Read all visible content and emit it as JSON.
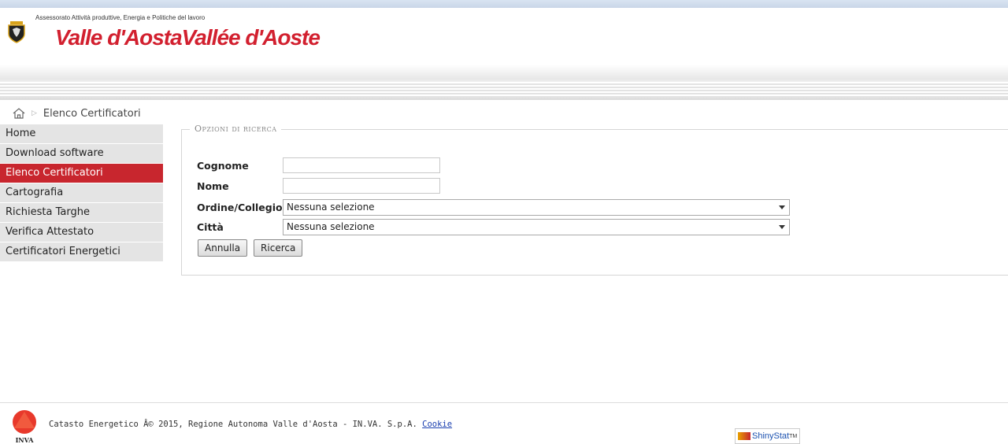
{
  "header": {
    "assessorato": "Assessorato Attività produttive, Energia e Politiche del lavoro",
    "wordmark": "Valle d'AostaVallée d'Aoste"
  },
  "breadcrumb": {
    "icon": "home-icon",
    "current": "Elenco Certificatori"
  },
  "sidebar": {
    "items": [
      {
        "label": "Home",
        "active": false
      },
      {
        "label": "Download software",
        "active": false
      },
      {
        "label": "Elenco Certificatori",
        "active": true
      },
      {
        "label": "Cartografia",
        "active": false
      },
      {
        "label": "Richiesta Targhe",
        "active": false
      },
      {
        "label": "Verifica Attestato",
        "active": false
      },
      {
        "label": "Certificatori Energetici",
        "active": false
      }
    ]
  },
  "search": {
    "legend": "Opzioni di ricerca",
    "cognome_label": "Cognome",
    "cognome_value": "",
    "nome_label": "Nome",
    "nome_value": "",
    "ordine_label": "Ordine/Collegio",
    "ordine_selected": "Nessuna selezione",
    "citta_label": "Città",
    "citta_selected": "Nessuna selezione",
    "annulla_label": "Annulla",
    "ricerca_label": "Ricerca"
  },
  "footer": {
    "text": "Catasto Energetico Â© 2015, Regione Autonoma Valle d'Aosta - IN.VA. S.p.A.",
    "cookie_link": "Cookie",
    "logo_text": "INVA",
    "badge_name": "ShinyStat",
    "badge_tm": "TM"
  },
  "colors": {
    "accent": "#c8262e",
    "sidebar_bg": "#e4e4e4",
    "link": "#1a3fb0"
  }
}
